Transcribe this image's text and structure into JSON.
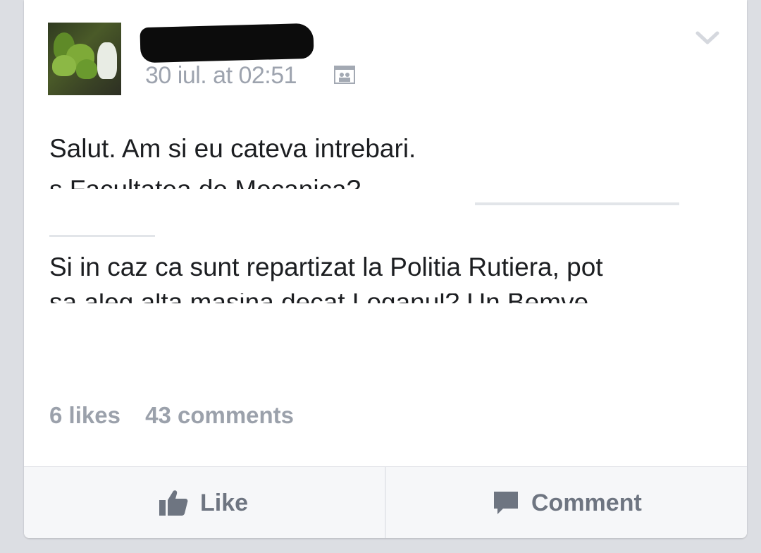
{
  "post": {
    "timestamp": "30 iul. at 02:51",
    "text_line_1": "Salut. Am si eu cateva intrebari.",
    "text_line_1_cut": "s Facultatea de Mecanica?",
    "text_line_2": "Si in caz ca sunt repartizat la Politia Rutiera, pot",
    "text_line_2_cut": "sa aleg alta masina decat Loganul? Un Bemve"
  },
  "stats": {
    "likes": "6 likes",
    "comments": "43 comments"
  },
  "actions": {
    "like_label": "Like",
    "comment_label": "Comment"
  },
  "icons": {
    "privacy": "friends-icon",
    "menu": "chevron-down-icon",
    "like": "thumbs-up-icon",
    "comment": "speech-bubble-icon"
  },
  "colors": {
    "meta_gray": "#9da3ae",
    "action_gray": "#6e7581",
    "text": "#1c1e21"
  }
}
